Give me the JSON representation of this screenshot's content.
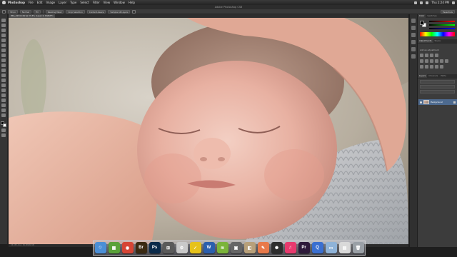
{
  "menubar": {
    "items": [
      "Photoshop",
      "File",
      "Edit",
      "Image",
      "Layer",
      "Type",
      "Select",
      "Filter",
      "View",
      "Window",
      "Help"
    ],
    "clock": "Thu 2:24 PM"
  },
  "window": {
    "title": "Adobe Photoshop CS6"
  },
  "options_bar": {
    "size": "30 px",
    "mode_label": "Normal",
    "fill_label": "Fill",
    "button_1": "Resizing Mask",
    "button_2": "Crop Selection",
    "button_3": "Content-Aware",
    "button_4": "Sample All Layers",
    "workspace": "Essentials"
  },
  "document": {
    "tab_label": "IMG_0234.CR2 @ 33.3% (Layer 0, RGB/8*)",
    "status": "33.33%   Doc: 30.5M/30.5M"
  },
  "panels": {
    "color_tabs": [
      "Color",
      "Swatches"
    ],
    "adjust_tabs": [
      "Adjustments",
      "Styles"
    ],
    "adjust_hint": "Add an adjustment",
    "layers_tabs": [
      "Layers",
      "Channels",
      "Paths"
    ],
    "layer_name": "Background"
  },
  "dock": {
    "apps": [
      {
        "name": "finder",
        "glyph": "☺",
        "color": "#4b8fd6"
      },
      {
        "name": "mission-control",
        "glyph": "▦",
        "color": "#5aa23a"
      },
      {
        "name": "chrome",
        "glyph": "◉",
        "color": "#d64535"
      },
      {
        "name": "bridge",
        "glyph": "Br",
        "color": "#3a2a12"
      },
      {
        "name": "photoshop",
        "glyph": "Ps",
        "color": "#0a2a4a"
      },
      {
        "name": "spaces",
        "glyph": "⊞",
        "color": "#5a5a5a"
      },
      {
        "name": "scripts",
        "glyph": "⚙",
        "color": "#c9c9c9"
      },
      {
        "name": "norton",
        "glyph": "✓",
        "color": "#e6c21a"
      },
      {
        "name": "word",
        "glyph": "W",
        "color": "#2b5fae"
      },
      {
        "name": "spotify",
        "glyph": "≋",
        "color": "#7bb43a"
      },
      {
        "name": "preview",
        "glyph": "▣",
        "color": "#666666"
      },
      {
        "name": "camera-raw",
        "glyph": "◧",
        "color": "#b8a07a"
      },
      {
        "name": "pages",
        "glyph": "✎",
        "color": "#e8794a"
      },
      {
        "name": "aperture",
        "glyph": "✺",
        "color": "#2e2e2e"
      },
      {
        "name": "itunes",
        "glyph": "♫",
        "color": "#e83a6e"
      },
      {
        "name": "premiere",
        "glyph": "Pr",
        "color": "#2d1a3a"
      },
      {
        "name": "quicktime",
        "glyph": "Q",
        "color": "#3a6fd0"
      },
      {
        "name": "downloads",
        "glyph": "▭",
        "color": "#8fb3d8"
      },
      {
        "name": "documents",
        "glyph": "▤",
        "color": "#d9d9d9"
      },
      {
        "name": "trash",
        "glyph": "🗑",
        "color": "#9aa0a6"
      }
    ]
  }
}
